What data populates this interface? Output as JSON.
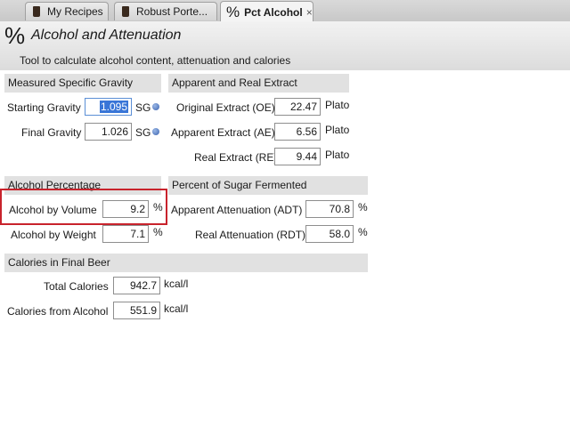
{
  "tabs": [
    {
      "label": "My Recipes",
      "closable": false,
      "active": false,
      "icon": "beer-mug-icon"
    },
    {
      "label": "Robust Porte...",
      "closable": false,
      "active": false,
      "icon": "beer-mug-icon"
    },
    {
      "label": "Pct Alcohol",
      "closable": true,
      "active": true,
      "icon": "percent-icon",
      "icon_glyph": "%",
      "close_glyph": "×"
    }
  ],
  "header": {
    "icon_glyph": "%",
    "title": "Alcohol and Attenuation",
    "subtitle": "Tool to calculate alcohol content, attenuation and calories"
  },
  "gravity": {
    "heading": "Measured Specific Gravity",
    "starting_label": "Starting Gravity",
    "starting_value": "1.095",
    "final_label": "Final Gravity",
    "final_value": "1.026",
    "unit": "SG"
  },
  "extract": {
    "heading": "Apparent and Real Extract",
    "oe_label": "Original Extract (OE)",
    "oe_value": "22.47",
    "ae_label": "Apparent Extract (AE)",
    "ae_value": "6.56",
    "re_label": "Real Extract (RE)",
    "re_value": "9.44",
    "unit": "Plato"
  },
  "alcohol": {
    "heading": "Alcohol Percentage",
    "abv_label": "Alcohol by Volume",
    "abv_value": "9.2",
    "abw_label": "Alcohol by Weight",
    "abw_value": "7.1",
    "unit": "%"
  },
  "fermented": {
    "heading": "Percent of Sugar Fermented",
    "adt_label": "Apparent Attenuation (ADT)",
    "adt_value": "70.8",
    "rdt_label": "Real Attenuation (RDT)",
    "rdt_value": "58.0",
    "unit": "%"
  },
  "calories": {
    "heading": "Calories in Final Beer",
    "total_label": "Total Calories",
    "total_value": "942.7",
    "alcohol_label": "Calories from Alcohol",
    "alcohol_value": "551.9",
    "unit": "kcal/l"
  },
  "colors": {
    "highlight": "#c8232c",
    "selection": "#3875d7",
    "section_bg": "#e1e1e1"
  }
}
